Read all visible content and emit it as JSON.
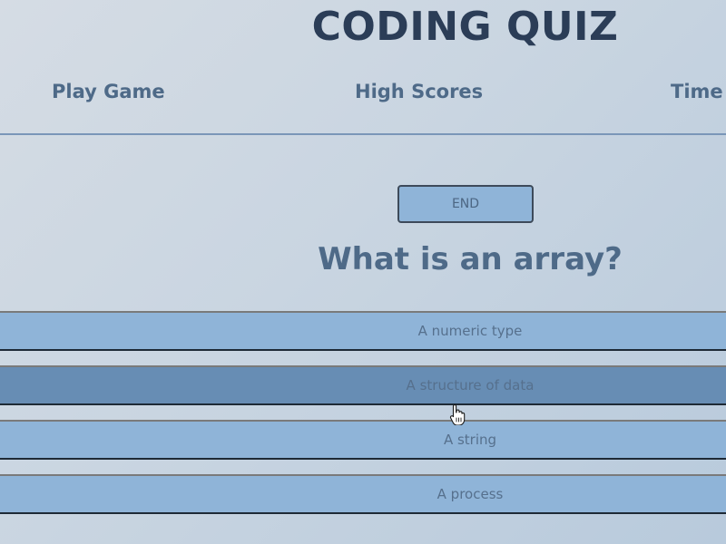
{
  "header": {
    "title": "CODING QUIZ"
  },
  "nav": {
    "play_game": "Play Game",
    "high_scores": "High Scores",
    "time": "Time"
  },
  "controls": {
    "end_label": "END"
  },
  "quiz": {
    "question": "What is an array?",
    "answers": [
      {
        "label": "A numeric type"
      },
      {
        "label": "A structure of data",
        "hovered": true
      },
      {
        "label": "A string"
      },
      {
        "label": "A process"
      }
    ]
  },
  "colors": {
    "title": "#2b3d57",
    "nav_text": "#4e6a88",
    "answer_bg": "#8fb4d8",
    "answer_hover_bg": "#678db4",
    "divider": "#7a96b8"
  },
  "icons": {
    "cursor": "hand-pointer-icon"
  }
}
